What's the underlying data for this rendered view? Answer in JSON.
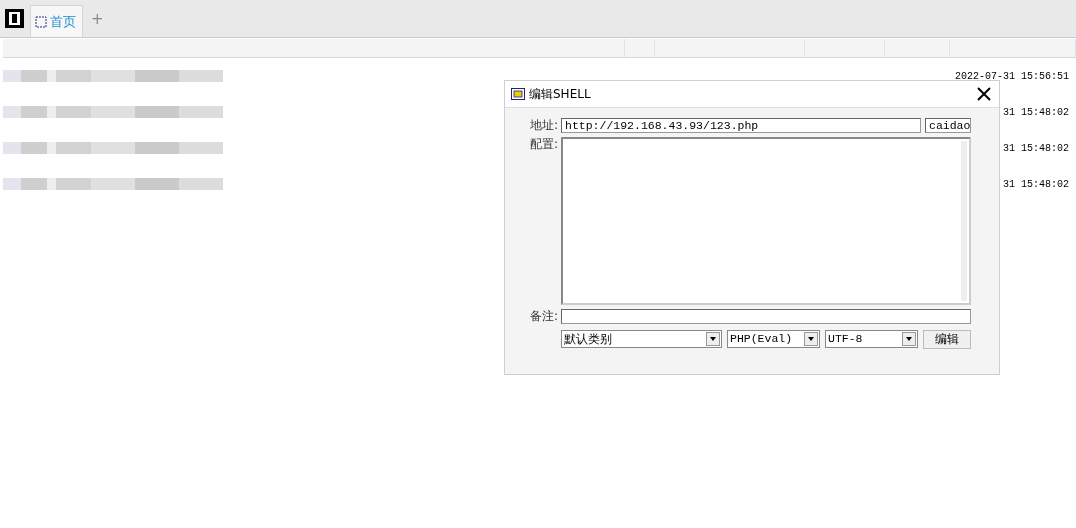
{
  "tabs": [
    {
      "label": "首页",
      "selected": true
    }
  ],
  "new_tab_button": "+",
  "table": {
    "rows": [
      {
        "time": "2022-07-31 15:56:51"
      },
      {
        "time": "31 15:48:02"
      },
      {
        "time": "31 15:48:02"
      },
      {
        "time": "31 15:48:02"
      }
    ]
  },
  "dialog": {
    "title": "编辑SHELL",
    "address_label": "地址:",
    "address_value": "http://192.168.43.93/123.php",
    "type_value": "caidao",
    "config_label": "配置:",
    "notes_label": "备注:",
    "selects": [
      {
        "value": "默认类别"
      },
      {
        "value": "PHP(Eval)"
      },
      {
        "value": "UTF-8"
      }
    ],
    "button": "编辑"
  }
}
